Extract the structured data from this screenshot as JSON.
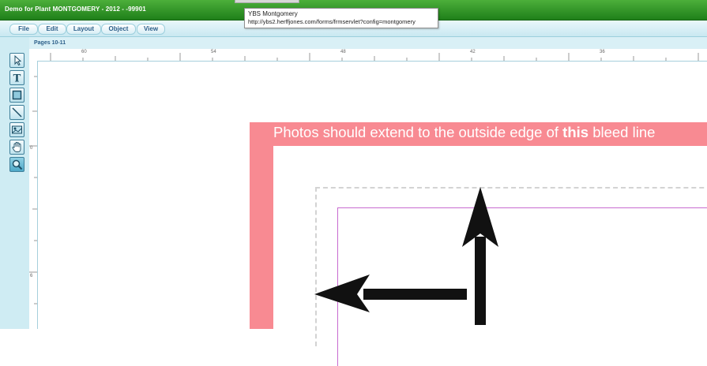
{
  "window": {
    "title": "Demo for Plant MONTGOMERY - 2012 - -99901"
  },
  "tooltip": {
    "title": "YBS Montgomery",
    "url": "http://ybs2.herffjones.com/forms/frmservlet?config=montgomery"
  },
  "menu": {
    "items": [
      {
        "label": "File"
      },
      {
        "label": "Edit"
      },
      {
        "label": "Layout"
      },
      {
        "label": "Object"
      },
      {
        "label": "View"
      }
    ]
  },
  "tools": [
    {
      "name": "select-arrow-icon"
    },
    {
      "name": "text-tool-icon"
    },
    {
      "name": "rectangle-tool-icon"
    },
    {
      "name": "line-tool-icon"
    },
    {
      "name": "image-tool-icon"
    },
    {
      "name": "hand-pan-icon"
    },
    {
      "name": "zoom-magnifier-icon"
    }
  ],
  "pages_label": "Pages 10-11",
  "ruler": {
    "horizontal": [
      "60",
      "54",
      "48",
      "42",
      "36"
    ],
    "vertical": [
      "0",
      "6"
    ]
  },
  "bleed_notice": {
    "prefix": "Photos should extend to the outside edge of ",
    "emphasis": "this",
    "suffix": " bleed line"
  },
  "colors": {
    "titlebar": "#2e9a27",
    "menubar": "#d6eef5",
    "bleed": "#f88a92",
    "margin_line": "#c86bd0",
    "arrow": "#111111"
  }
}
